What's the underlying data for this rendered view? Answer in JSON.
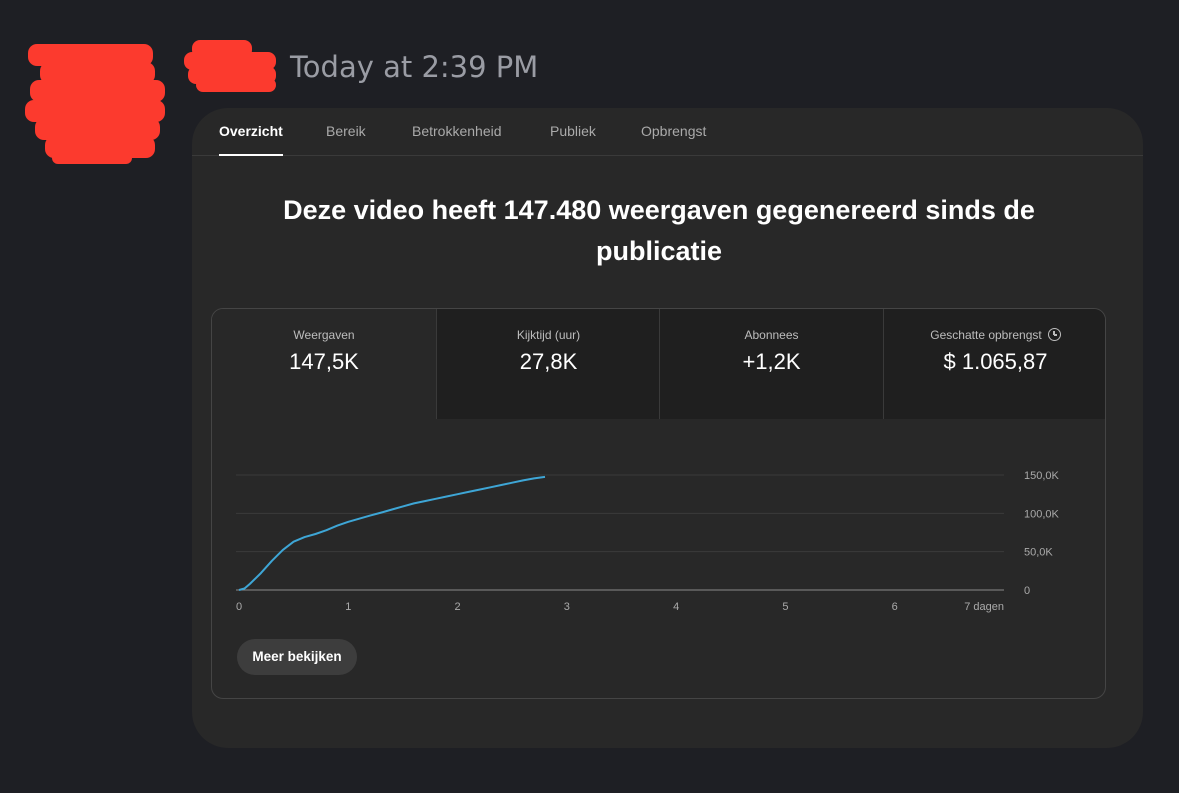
{
  "message": {
    "timestamp": "Today at 2:39 PM"
  },
  "tabs": [
    {
      "label": "Overzicht",
      "active": true
    },
    {
      "label": "Bereik",
      "active": false
    },
    {
      "label": "Betrokkenheid",
      "active": false
    },
    {
      "label": "Publiek",
      "active": false
    },
    {
      "label": "Opbrengst",
      "active": false
    }
  ],
  "headline": "Deze video heeft 147.480 weergaven gegenereerd sinds de publicatie",
  "metrics": [
    {
      "label": "Weergaven",
      "value": "147,5K"
    },
    {
      "label": "Kijktijd (uur)",
      "value": "27,8K"
    },
    {
      "label": "Abonnees",
      "value": "+1,2K"
    },
    {
      "label": "Geschatte opbrengst",
      "value": "$ 1.065,87",
      "icon": "clock-icon"
    }
  ],
  "more_button": "Meer bekijken",
  "colors": {
    "line": "#3ea6d6",
    "background": "#1e1f24",
    "card": "#282828"
  },
  "chart_data": {
    "type": "line",
    "x_ticks": [
      "0",
      "1",
      "2",
      "3",
      "4",
      "5",
      "6",
      "7 dagen"
    ],
    "y_ticks": [
      "0",
      "50,0K",
      "100,0K",
      "150,0K"
    ],
    "xlim": [
      0,
      7
    ],
    "ylim": [
      0,
      150000
    ],
    "grid": true,
    "series": [
      {
        "x": [
          0,
          0.05,
          0.1,
          0.2,
          0.3,
          0.4,
          0.5,
          0.6,
          0.7,
          0.8,
          0.9,
          1.0,
          1.1,
          1.2,
          1.3,
          1.4,
          1.5,
          1.6,
          1.7,
          1.8,
          1.9,
          2.0,
          2.1,
          2.2,
          2.3,
          2.4,
          2.5,
          2.6,
          2.7,
          2.8
        ],
        "y": [
          0,
          2000,
          8000,
          22000,
          38000,
          52000,
          63000,
          69000,
          73000,
          78000,
          84000,
          89000,
          93000,
          97000,
          101000,
          105000,
          109000,
          113000,
          116000,
          119000,
          122000,
          125000,
          128000,
          131000,
          134000,
          137000,
          140000,
          143000,
          145500,
          147480
        ]
      }
    ]
  }
}
